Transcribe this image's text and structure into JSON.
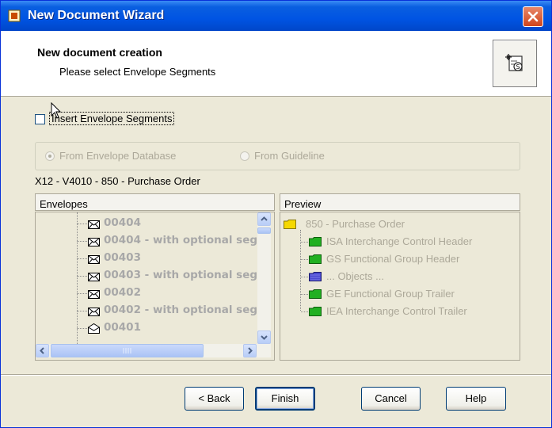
{
  "window": {
    "title": "New Document Wizard",
    "title_icon": "document-wizard-icon",
    "close_icon": "close-icon"
  },
  "header": {
    "title": "New document creation",
    "subtitle": "Please select Envelope Segments",
    "icon": "new-document-s-icon"
  },
  "insert_envelope": {
    "label": "Insert Envelope Segments",
    "checked": false
  },
  "source_group": {
    "options": [
      {
        "label": "From Envelope Database",
        "selected": true,
        "enabled": false
      },
      {
        "label": "From Guideline",
        "selected": false,
        "enabled": false
      }
    ]
  },
  "context_label": "X12 - V4010 - 850 - Purchase Order",
  "envelopes": {
    "header": "Envelopes",
    "items": [
      {
        "label": "00404",
        "icon": "envelope-icon"
      },
      {
        "label": "00404 - with optional seg",
        "icon": "envelope-icon"
      },
      {
        "label": "00403",
        "icon": "envelope-icon"
      },
      {
        "label": "00403 - with optional seg",
        "icon": "envelope-icon"
      },
      {
        "label": "00402",
        "icon": "envelope-icon"
      },
      {
        "label": "00402 - with optional seg",
        "icon": "envelope-icon"
      },
      {
        "label": "00401",
        "icon": "open-envelope-icon"
      }
    ]
  },
  "preview": {
    "header": "Preview",
    "root": {
      "label": "850 - Purchase Order",
      "icon": "yellow-folder-icon"
    },
    "items": [
      {
        "label": "ISA  Interchange Control Header",
        "icon": "green-folder-icon"
      },
      {
        "label": "GS  Functional Group Header",
        "icon": "green-folder-icon"
      },
      {
        "label": "... Objects ...",
        "icon": "blue-folder-icon"
      },
      {
        "label": "GE  Functional Group Trailer",
        "icon": "green-folder-icon"
      },
      {
        "label": "IEA  Interchange Control Trailer",
        "icon": "green-folder-icon"
      }
    ]
  },
  "buttons": {
    "back": "< Back",
    "finish": "Finish",
    "cancel": "Cancel",
    "help": "Help"
  },
  "colors": {
    "title_bar": "#0054e3",
    "dialog_bg": "#ece9d8",
    "disabled_text": "#aca899",
    "green_folder": "#22b022",
    "yellow_folder": "#f5d800",
    "blue_folder": "#4a4ad0"
  }
}
